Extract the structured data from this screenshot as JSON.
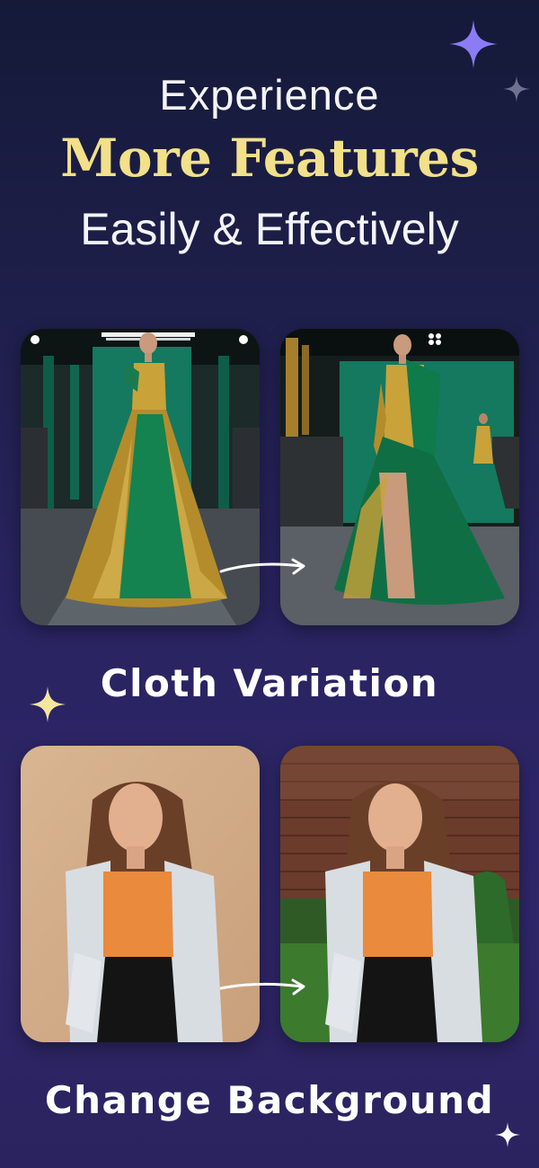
{
  "headline": {
    "line1": "Experience",
    "line2": "More Features",
    "line3": "Easily & Effectively"
  },
  "features": [
    {
      "title": "Cloth Variation",
      "before_icon": "runway-model-gown-photo",
      "after_icon": "runway-model-feather-dress-photo",
      "arrow_icon": "curved-arrow-icon"
    },
    {
      "title": "Change Background",
      "before_icon": "woman-portrait-plain-background-photo",
      "after_icon": "woman-portrait-brick-garden-background-photo",
      "arrow_icon": "curved-arrow-icon"
    }
  ],
  "colors": {
    "accent_gold": "#f2e08a",
    "sparkle_purple": "#8b7cf6",
    "sparkle_yellow": "#f3e7a0",
    "sparkle_grey": "#6f7190"
  }
}
